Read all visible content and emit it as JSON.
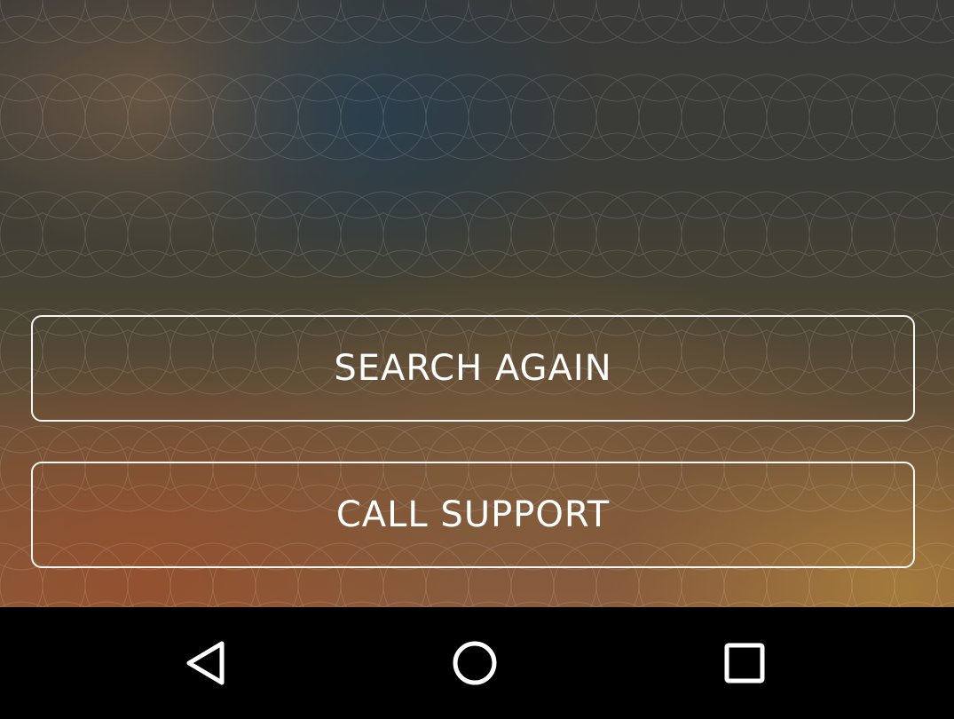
{
  "actions": {
    "search_again_label": "SEARCH AGAIN",
    "call_support_label": "CALL SUPPORT"
  },
  "system_nav": {
    "back_icon": "back-triangle",
    "home_icon": "home-circle",
    "recents_icon": "recents-square"
  },
  "colors": {
    "button_border": "#ffffff",
    "button_text": "#ffffff",
    "nav_bar_background": "#000000"
  }
}
